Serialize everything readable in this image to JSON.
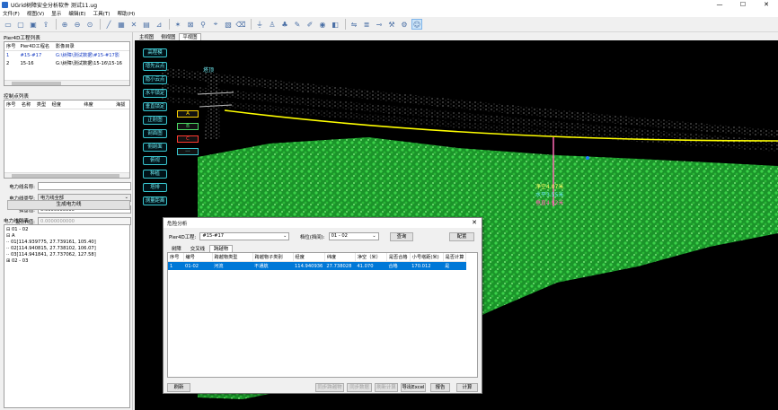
{
  "window": {
    "title": "UGrid树障安全分析软件 测试11.ug",
    "controls": [
      "—",
      "☐",
      "✕"
    ]
  },
  "menu": [
    "文件(F)",
    "视图(V)",
    "显示",
    "编辑(E)",
    "工具(T)",
    "帮助(H)"
  ],
  "toolbar_icons": [
    "open-folder-icon",
    "new-file-icon",
    "save-icon",
    "export-icon",
    "sep",
    "zoom-in-icon",
    "zoom-out-icon",
    "zoom-fit-icon",
    "sep",
    "line-tool-icon",
    "grid-tool-icon",
    "cross-tool-icon",
    "chart-tool-icon",
    "ruler-tool-icon",
    "sep",
    "clean-icon",
    "delete-box-icon",
    "link-icon",
    "pin-icon",
    "image-icon",
    "eraser-icon",
    "sep",
    "pylon-icon",
    "tower-icon",
    "tree-icon",
    "paint-icon",
    "pen-icon",
    "eye-icon",
    "mirror-icon",
    "sep",
    "flip-icon",
    "layers-icon",
    "measure-icon",
    "wrench-icon",
    "settings-icon",
    "person-icon"
  ],
  "left": {
    "pier_section_title": "Pier4D工程列表",
    "pier_columns": [
      "序号",
      "Pier4D工程名",
      "影像目录"
    ],
    "pier_rows": [
      [
        "1",
        "#15-#17",
        "G:\\树障\\测试数据\\#15-#17影"
      ],
      [
        "2",
        "15-16",
        "G:\\树障\\测试数据\\15-16\\15-16"
      ]
    ],
    "ctrl_section_title": "控制点列表",
    "ctrl_columns": [
      "序号",
      "名称",
      "类型",
      "经度",
      "纬度",
      "海拔"
    ],
    "form": {
      "name_label": "电力线名称:",
      "name_value": "",
      "type_label": "电力线类型:",
      "type_value": "电力线全部",
      "sag_label": "弧垂值:",
      "sag_value": "0.0000000000",
      "design_label": "设计H值:",
      "design_value": "0.0000000000"
    },
    "generate_btn": "生成电力线",
    "line_section_title": "电力线列表",
    "tree": [
      "⊟ 01 - 02",
      "    ⊟ A",
      "        ·· 01[114.939775, 27.739161, 105.40]",
      "        ·· 02[114.940815, 27.738102, 106.07]",
      "        ·· 03[114.941841, 27.737062, 127.58]",
      "⊞ 02 - 03"
    ]
  },
  "view_tabs": [
    "主视图",
    "侧视图",
    "平视图"
  ],
  "viewport": {
    "side_buttons": [
      "高程模",
      "增先云点",
      "隐小云点",
      "水平锁定",
      "垂直锁定",
      "正射图",
      "剖面图",
      "侧剖面",
      "俯视",
      "种植",
      "塔排",
      "测量距离"
    ],
    "phase_buttons": [
      "A",
      "B",
      "C"
    ],
    "tower_label": "塔顶",
    "measure": {
      "clear": "净空4.07米",
      "horizontal": "水平3.55米",
      "vertical": "垂直4.92米"
    },
    "colors": {
      "line": "#ffff00",
      "vertical": "#ff69b4",
      "vegetation": "#22c33a"
    }
  },
  "dialog": {
    "title": "危险分析",
    "close": "✕",
    "project_label": "Pier4D工程:",
    "project_value": "#15-#17",
    "span_label": "档位(挡间):",
    "span_value": "01 - 02",
    "query_btn": "查询",
    "config_btn": "配置",
    "tabs": [
      "树障",
      "交叉线",
      "跨越物"
    ],
    "columns": [
      "序号",
      "编号",
      "跨越物类型",
      "跨越物子类别",
      "经度",
      "纬度",
      "净空（米）",
      "是否合格",
      "小号塔距(米)",
      "是否计算"
    ],
    "rows": [
      [
        "1",
        "01-02",
        "河流",
        "不通航",
        "114.940936",
        "27.738028",
        "41.070",
        "合格",
        "170.012",
        "是"
      ]
    ],
    "buttons": {
      "refresh": "刷新",
      "sync_cross": "同步跨越物",
      "sync_data": "同步数据",
      "sync_back": "刷新计算",
      "export": "导出Excel",
      "report": "报告",
      "compute": "计算"
    }
  }
}
